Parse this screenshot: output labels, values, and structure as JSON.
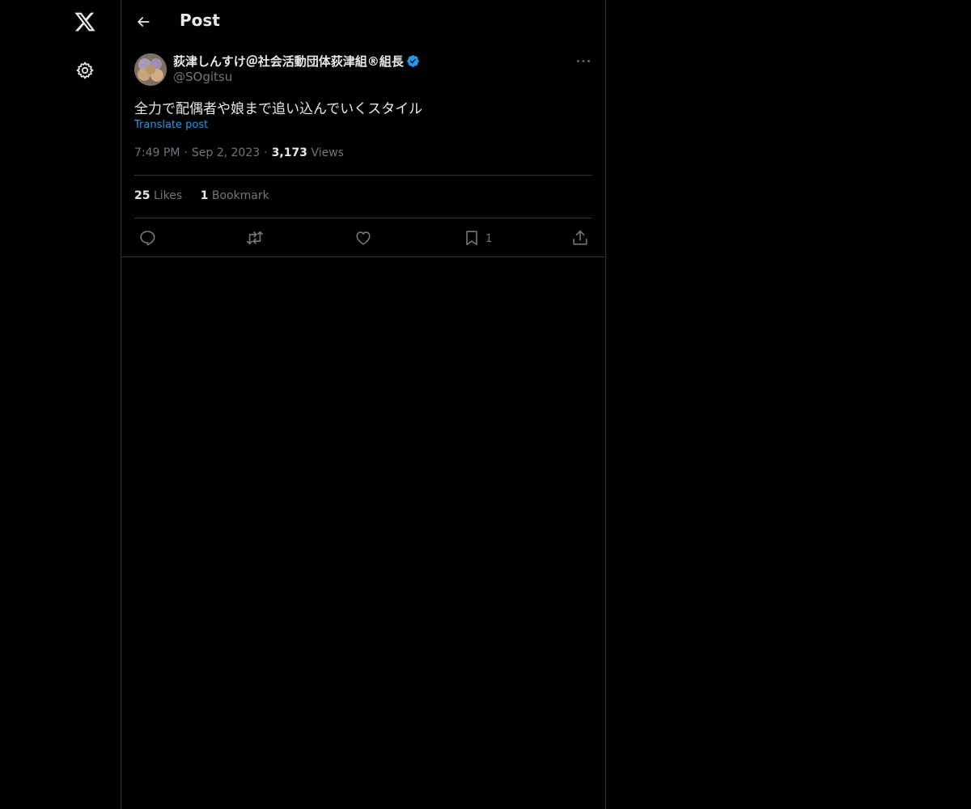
{
  "header": {
    "title": "Post"
  },
  "nav": {
    "logo_icon": "x-logo-icon",
    "settings_icon": "gear-icon"
  },
  "post": {
    "author": {
      "display_name": "荻津しんすけ＠社会活動団体荻津組®組長",
      "handle": "@SOgitsu",
      "verified": true
    },
    "text": "全力で配偶者や娘まで追い込んでいくスタイル",
    "translate_label": "Translate post",
    "time": "7:49 PM",
    "date": "Sep 2, 2023",
    "views_count": "3,173",
    "views_label": "Views",
    "separator": "·",
    "stats": {
      "likes_count": "25",
      "likes_label": "Likes",
      "bookmarks_count": "1",
      "bookmarks_label": "Bookmark"
    },
    "actions": {
      "bookmark_count": "1"
    }
  },
  "colors": {
    "background": "#000000",
    "text": "#e7e9ea",
    "secondary_text": "#71767b",
    "accent": "#1d9bf0",
    "border": "#2f3336"
  }
}
